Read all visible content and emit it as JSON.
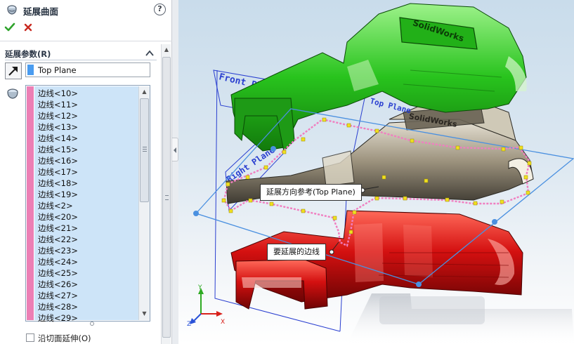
{
  "panel": {
    "title": "延展曲面",
    "help": "?",
    "section_title": "延展参数(R)",
    "reference_field": {
      "value": "Top Plane"
    },
    "edges": [
      "边线<10>",
      "边线<11>",
      "边线<12>",
      "边线<13>",
      "边线<14>",
      "边线<15>",
      "边线<16>",
      "边线<17>",
      "边线<18>",
      "边线<19>",
      "边线<2>",
      "边线<20>",
      "边线<21>",
      "边线<22>",
      "边线<23>",
      "边线<24>",
      "边线<25>",
      "边线<26>",
      "边线<27>",
      "边线<28>",
      "边线<29>"
    ],
    "tangent_checkbox": {
      "label": "沿切面延伸(O)",
      "checked": false
    },
    "colors": {
      "reference_swatch": "#4a9cf0",
      "edges_swatch": "#ec7fb5",
      "list_selection": "#cde4f8"
    }
  },
  "viewport": {
    "plane_labels": {
      "front": "Front Plane",
      "right": "Right Plane",
      "top": "Top Plane"
    },
    "logo_text": "SolidWorks",
    "callouts": {
      "direction": "延展方向参考(Top Plane)",
      "edges": "要延展的边线"
    },
    "triad": {
      "x": "X",
      "y": "Y",
      "z": "Z"
    },
    "colors": {
      "top_part": "#25c420",
      "middle_part": "#a89e88",
      "bottom_part": "#d81818",
      "plane": "#2a3fd0",
      "spread_plane": "#4a90e0",
      "edge_highlight": "#f07ec0",
      "edge_points": "#f0e020"
    }
  }
}
